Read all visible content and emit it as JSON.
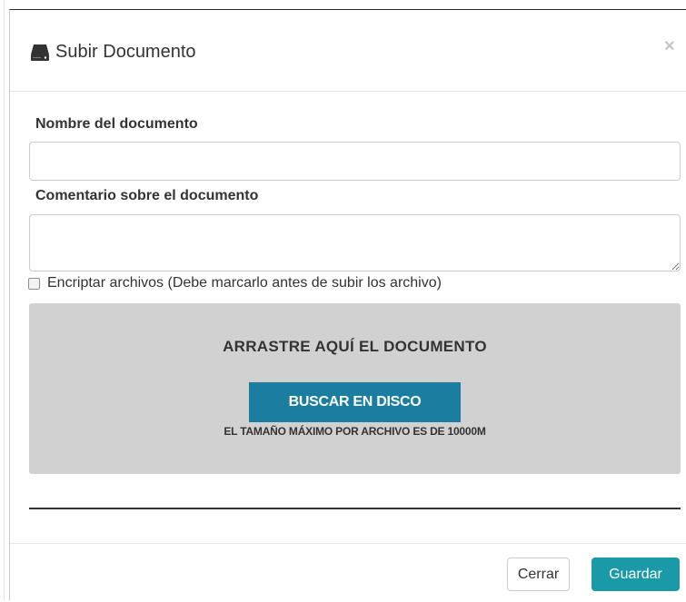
{
  "modal": {
    "title": "Subir Documento",
    "title_icon": "hdd-icon",
    "close_symbol": "×"
  },
  "form": {
    "name_label": "Nombre del documento",
    "name_value": "",
    "comment_label": "Comentario sobre el documento",
    "comment_value": "",
    "encrypt_label": "Encriptar archivos (Debe marcarlo antes de subir los archivo)",
    "encrypt_checked": false
  },
  "dropzone": {
    "title": "ARRASTRE AQUÍ EL DOCUMENTO",
    "browse_label": "BUSCAR EN DISCO",
    "note": "EL TAMAÑO MÁXIMO POR ARCHIVO ES DE 10000M"
  },
  "footer": {
    "close_label": "Cerrar",
    "save_label": "Guardar"
  },
  "colors": {
    "browse_button": "#1b7ea0",
    "save_button": "#1a9aa8",
    "dropzone_bg": "#d1d1d1"
  }
}
